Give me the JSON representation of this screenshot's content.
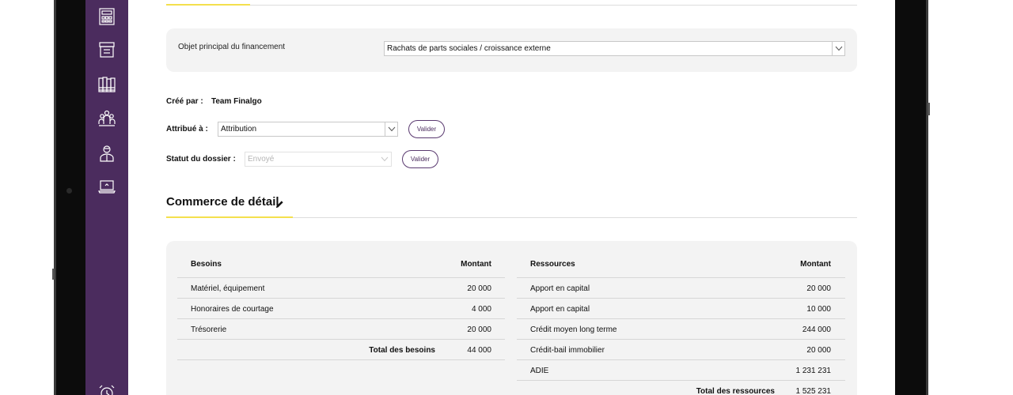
{
  "objet": {
    "label": "Objet principal du financement",
    "value": "Rachats de parts sociales / croissance externe"
  },
  "cree_par": {
    "label": "Créé par :",
    "value": "Team Finalgo"
  },
  "attribue": {
    "label": "Attribué à :",
    "value": "Attribution",
    "button": "Valider"
  },
  "statut": {
    "label": "Statut du dossier :",
    "value": "Envoyé",
    "button": "Valider"
  },
  "section": {
    "title": "Commerce de détail"
  },
  "besoins": {
    "header": "Besoins",
    "amount_header": "Montant",
    "rows": [
      {
        "label": "Matériel, équipement",
        "amount": "20 000"
      },
      {
        "label": "Honoraires de courtage",
        "amount": "4 000"
      },
      {
        "label": "Trésorerie",
        "amount": "20 000"
      }
    ],
    "total_label": "Total des besoins",
    "total": "44 000"
  },
  "ressources": {
    "header": "Ressources",
    "amount_header": "Montant",
    "rows": [
      {
        "label": "Apport en capital",
        "amount": "20 000"
      },
      {
        "label": "Apport en capital",
        "amount": "10 000"
      },
      {
        "label": "Crédit moyen long terme",
        "amount": "244 000"
      },
      {
        "label": "Crédit-bail immobilier",
        "amount": "20 000"
      },
      {
        "label": "ADIE",
        "amount": "1 231 231"
      }
    ],
    "total_label": "Total des ressources",
    "total": "1 525 231"
  },
  "sidebar_icons": [
    "calculator-icon",
    "archive-box-icon",
    "binders-icon",
    "team-icon",
    "user-icon",
    "laptop-icon",
    "alarm-clock-icon"
  ],
  "colors": {
    "sidebar": "#4b2c5e",
    "accent": "#f4e04d",
    "panel": "#f3f3f3"
  }
}
